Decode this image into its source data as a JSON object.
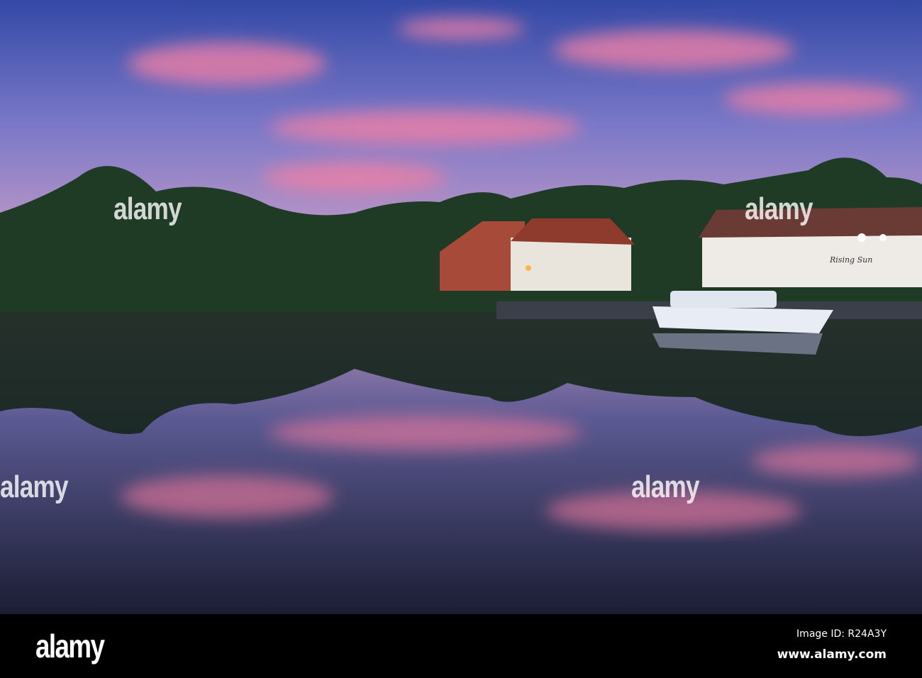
{
  "photo": {
    "subject": "river-pub-sunset",
    "pub_sign": "Rising Sun",
    "watermark": "alamy",
    "colors": {
      "sky_top": "#3a4fa8",
      "sky_mid": "#8a7bc8",
      "cloud_pink": "#e77aa0",
      "trees": "#1f3b22",
      "water_dark": "#1d2035"
    }
  },
  "footer": {
    "logo": "alamy",
    "image_id": "Image ID: R24A3Y",
    "url": "www.alamy.com"
  }
}
